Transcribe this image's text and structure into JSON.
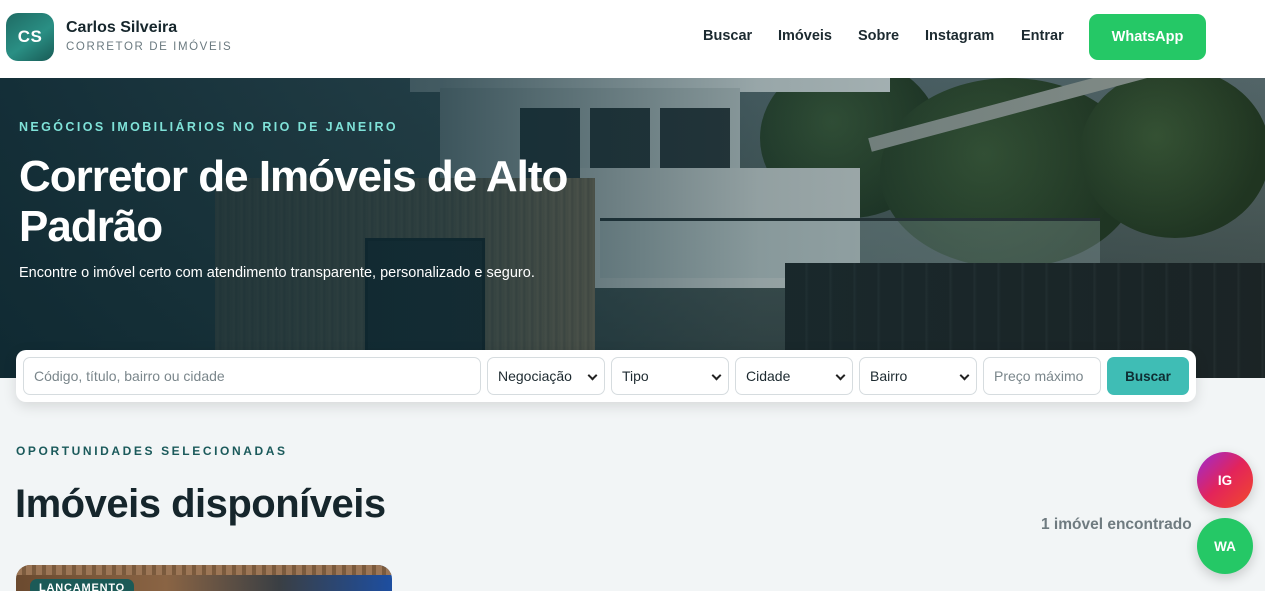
{
  "header": {
    "logo_initials": "CS",
    "brand_name": "Carlos Silveira",
    "brand_role": "CORRETOR DE IMÓVEIS",
    "nav": [
      {
        "label": "Buscar"
      },
      {
        "label": "Imóveis"
      },
      {
        "label": "Sobre"
      },
      {
        "label": "Instagram"
      },
      {
        "label": "Entrar"
      }
    ],
    "whatsapp_label": "WhatsApp"
  },
  "hero": {
    "eyebrow": "NEGÓCIOS IMOBILIÁRIOS NO RIO DE JANEIRO",
    "title": "Corretor de Imóveis de Alto Padrão",
    "subtitle": "Encontre o imóvel certo com atendimento transparente, personalizado e seguro."
  },
  "search": {
    "query_placeholder": "Código, título, bairro ou cidade",
    "negociacao": "Negociação",
    "tipo": "Tipo",
    "cidade": "Cidade",
    "bairro": "Bairro",
    "preco_placeholder": "Preço máximo",
    "button_label": "Buscar"
  },
  "listings": {
    "eyebrow": "OPORTUNIDADES SELECIONADAS",
    "title": "Imóveis disponíveis",
    "count_text": "1 imóvel encontrado",
    "cards": [
      {
        "badge": "LANÇAMENTO"
      }
    ]
  },
  "floating": {
    "instagram_label": "IG",
    "whatsapp_label": "WA"
  },
  "colors": {
    "accent_teal": "#3fbdb5",
    "whatsapp_green": "#25c866",
    "eyebrow_teal": "#7fe2d8"
  }
}
